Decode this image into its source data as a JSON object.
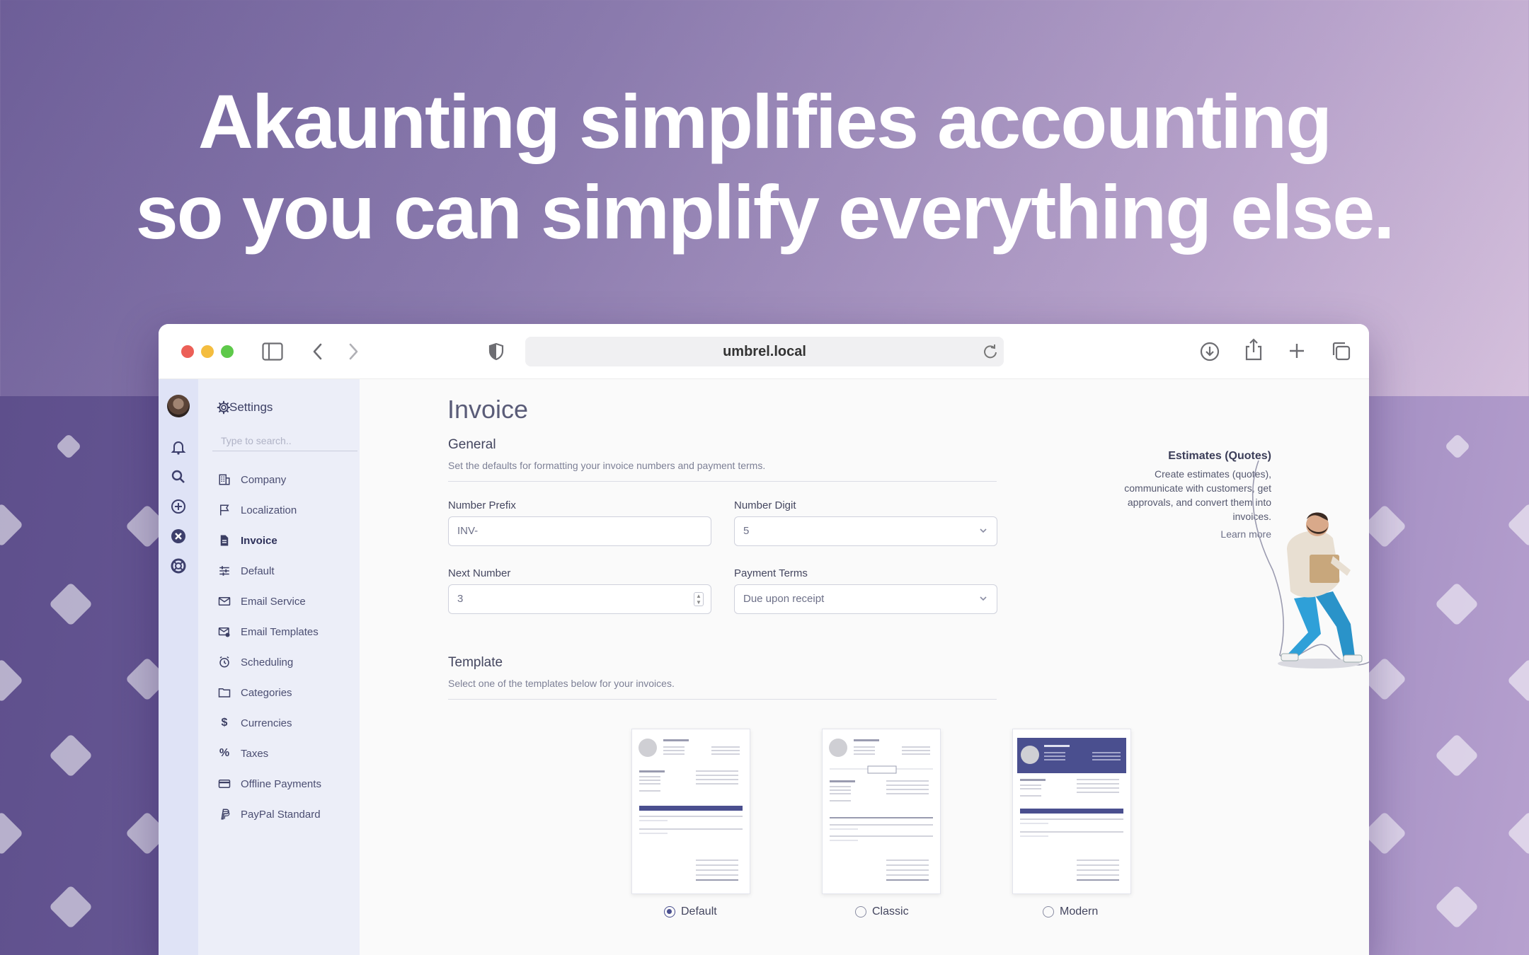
{
  "headline": {
    "line1": "Akaunting simplifies accounting",
    "line2": "so you can simplify everything else."
  },
  "browser": {
    "url": "umbrel.local",
    "icons": [
      "sidebar-toggle-icon",
      "back-icon",
      "forward-icon",
      "privacy-shield-icon",
      "reload-icon",
      "download-icon",
      "share-icon",
      "new-tab-icon",
      "tabs-overview-icon"
    ]
  },
  "rail": {
    "icons": [
      "avatar",
      "bell-icon",
      "search-icon",
      "plus-circle-icon",
      "close-circle-icon",
      "help-lifebuoy-icon"
    ]
  },
  "sidebar": {
    "title": "Settings",
    "search_placeholder": "Type to search..",
    "items": [
      {
        "label": "Company",
        "icon": "building-icon"
      },
      {
        "label": "Localization",
        "icon": "flag-icon"
      },
      {
        "label": "Invoice",
        "icon": "document-icon",
        "active": true
      },
      {
        "label": "Default",
        "icon": "sliders-icon"
      },
      {
        "label": "Email Service",
        "icon": "mail-icon"
      },
      {
        "label": "Email Templates",
        "icon": "mail-template-icon"
      },
      {
        "label": "Scheduling",
        "icon": "clock-icon"
      },
      {
        "label": "Categories",
        "icon": "folder-icon"
      },
      {
        "label": "Currencies",
        "icon": "dollar-icon"
      },
      {
        "label": "Taxes",
        "icon": "percent-icon"
      },
      {
        "label": "Offline Payments",
        "icon": "credit-card-icon"
      },
      {
        "label": "PayPal Standard",
        "icon": "paypal-icon"
      }
    ]
  },
  "main": {
    "title": "Invoice",
    "general": {
      "title": "General",
      "description": "Set the defaults for formatting your invoice numbers and payment terms."
    },
    "fields": {
      "number_prefix": {
        "label": "Number Prefix",
        "value": "INV-"
      },
      "number_digit": {
        "label": "Number Digit",
        "value": "5"
      },
      "next_number": {
        "label": "Next Number",
        "value": "3"
      },
      "payment_terms": {
        "label": "Payment Terms",
        "value": "Due upon receipt"
      }
    },
    "template": {
      "title": "Template",
      "description": "Select one of the templates below for your invoices.",
      "options": [
        {
          "label": "Default",
          "selected": true
        },
        {
          "label": "Classic",
          "selected": false
        },
        {
          "label": "Modern",
          "selected": false
        }
      ]
    }
  },
  "promo": {
    "title": "Estimates (Quotes)",
    "description": "Create estimates (quotes), communicate with customers, get approvals, and convert them into invoices.",
    "link": "Learn more"
  },
  "colors": {
    "accent": "#4a4f8f",
    "sidebar_bg": "#eceef8",
    "rail_bg": "#dfe3f6",
    "mac_red": "#ec5f57",
    "mac_yellow": "#f4bd3f",
    "mac_green": "#5ec94a"
  }
}
